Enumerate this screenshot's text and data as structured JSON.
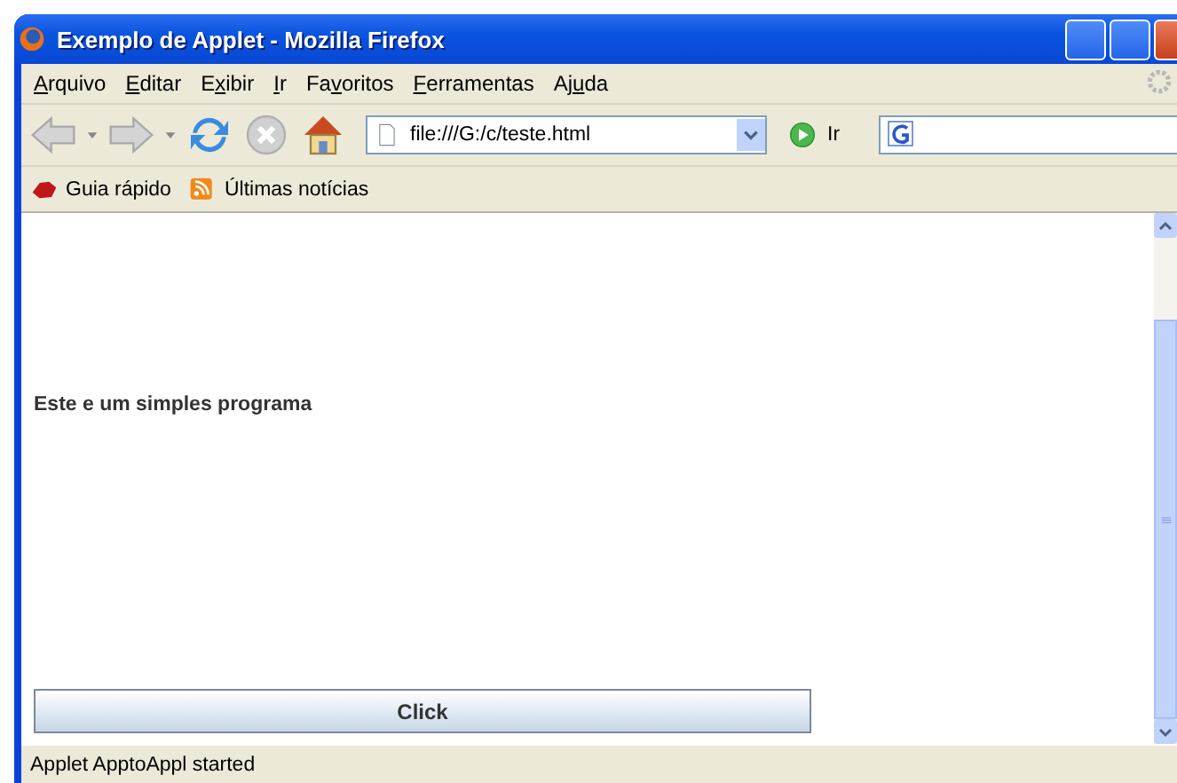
{
  "window": {
    "title": "Exemplo de Applet - Mozilla Firefox"
  },
  "menu": [
    {
      "key": "A",
      "after": "rquivo"
    },
    {
      "key": "E",
      "after": "ditar"
    },
    {
      "before": "E",
      "key": "x",
      "after": "ibir"
    },
    {
      "key": "I",
      "after": "r"
    },
    {
      "before": "Fa",
      "key": "v",
      "after": "oritos"
    },
    {
      "key": "F",
      "after": "erramentas"
    },
    {
      "before": "Aj",
      "key": "u",
      "after": "da"
    }
  ],
  "toolbar": {
    "address": "file:///G:/c/teste.html",
    "go_label": "Ir"
  },
  "bookmarks": [
    {
      "label": "Guia rápido",
      "kind": "guide"
    },
    {
      "label": "Últimas notícias",
      "kind": "feed"
    }
  ],
  "applet": {
    "text": "Este e um simples programa",
    "button": "Click"
  },
  "status_bar": "Applet ApptoAppl started"
}
